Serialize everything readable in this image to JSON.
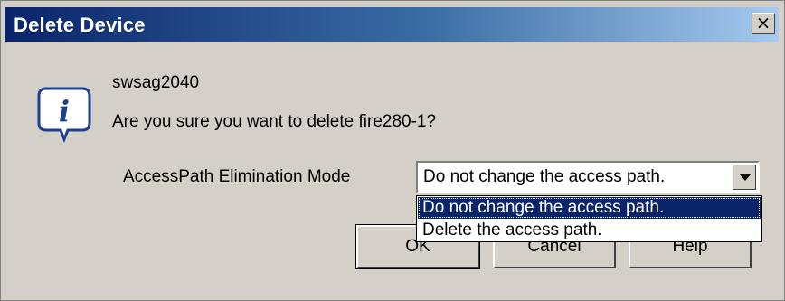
{
  "window": {
    "title": "Delete Device",
    "close_label": "×"
  },
  "icon": {
    "name": "info-icon",
    "glyph": "i"
  },
  "message": {
    "device": "swsag2040",
    "question": "Are you sure you want to delete fire280-1?"
  },
  "mode": {
    "label": "AccessPath Elimination Mode",
    "selected": "Do not change the access path.",
    "options": [
      "Do not change the access path.",
      "Delete the access path."
    ],
    "highlighted_index": 0
  },
  "buttons": {
    "ok": "OK",
    "cancel": "Cancel",
    "help": "Help"
  },
  "colors": {
    "title_gradient_start": "#0a246a",
    "title_gradient_end": "#a6caf0",
    "dialog_bg": "#d4d0c8",
    "highlight": "#0a246a"
  }
}
